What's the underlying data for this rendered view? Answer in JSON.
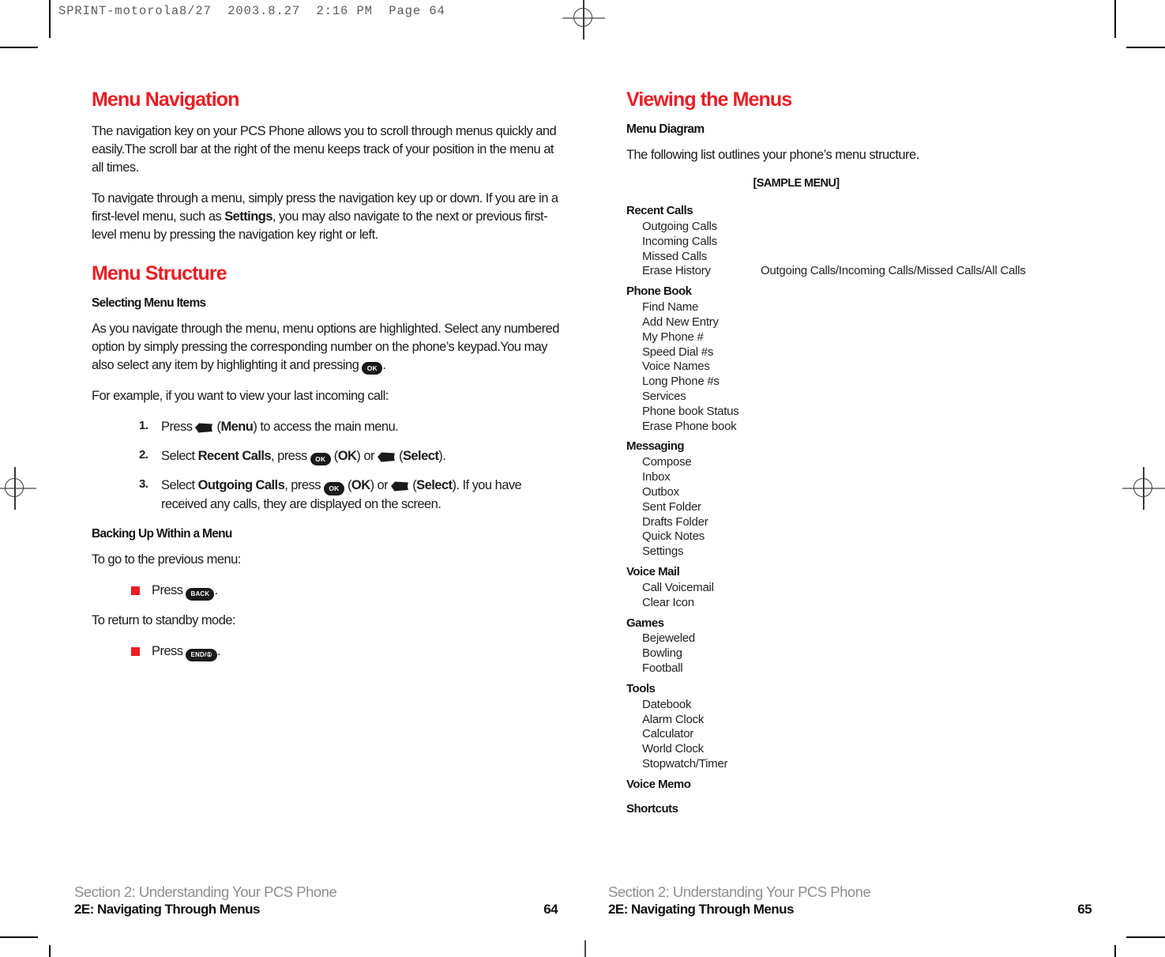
{
  "file_stamp": "SPRINT-motorola8/27  2003.8.27  2:16 PM  Page 64",
  "accent_red": "#ED1C24",
  "left_page": {
    "heading_1": "Menu Navigation",
    "para_1": "The navigation key on your PCS Phone allows you to scroll through menus quickly and easily.The scroll bar at the right of the menu keeps track of your position in the menu at all times.",
    "para_2_a": "To navigate through a menu, simply press the navigation key up or down. If you are in a first-level menu, such as ",
    "para_2_bold": "Settings",
    "para_2_b": ", you may also navigate to the next or previous first-level menu by pressing the navigation key right or left.",
    "heading_2": "Menu Structure",
    "subhead_1": "Selecting Menu Items",
    "para_3_a": "As you navigate through the menu, menu options are highlighted. Select any numbered option by simply pressing the corresponding number on the phone’s keypad.You may also select any item by highlighting it and pressing ",
    "para_3_b": ".",
    "para_4": "For example, if you want to view your last incoming call:",
    "steps": [
      {
        "num": "1.",
        "pre": "Press ",
        "key": "soft",
        "mid_open": " (",
        "label_bold": "Menu",
        "post": ") to access the main menu."
      },
      {
        "num": "2.",
        "pre": "Select ",
        "target_bold": "Recent Calls",
        "mid": ", press ",
        "ok_open": " (",
        "ok_bold": "OK",
        "ok_close": ") or ",
        "sel_open": " (",
        "sel_bold": "Select",
        "post": ")."
      },
      {
        "num": "3.",
        "pre": "Select ",
        "target_bold": "Outgoing Calls",
        "mid": ", press ",
        "ok_open": " (",
        "ok_bold": "OK",
        "ok_close": ") or ",
        "sel_open": " (",
        "sel_bold": "Select",
        "post": "). If you have received any calls, they are displayed on the screen."
      }
    ],
    "subhead_2": "Backing Up Within a Menu",
    "para_5": "To go to the previous menu:",
    "bullet_1_pre": "Press ",
    "bullet_1_key": "BACK",
    "bullet_1_post": ".",
    "para_6": "To return to standby mode:",
    "bullet_2_pre": "Press ",
    "bullet_2_key": "END/①",
    "bullet_2_post": ".",
    "footer_section": "Section 2: Understanding Your PCS Phone",
    "footer_title": "2E: Navigating Through Menus",
    "footer_page": "64"
  },
  "right_page": {
    "heading_1": "Viewing the Menus",
    "subhead_1": "Menu Diagram",
    "para_1": "The following list outlines your phone’s menu structure.",
    "sample_label": "[SAMPLE MENU]",
    "menu_groups": [
      {
        "title": "Recent Calls",
        "items": [
          {
            "label": "Outgoing Calls",
            "detail": ""
          },
          {
            "label": "Incoming Calls",
            "detail": ""
          },
          {
            "label": "Missed Calls",
            "detail": ""
          },
          {
            "label": "Erase History",
            "detail": "Outgoing Calls/Incoming Calls/Missed Calls/All Calls"
          }
        ]
      },
      {
        "title": "Phone Book",
        "items": [
          {
            "label": "Find Name",
            "detail": ""
          },
          {
            "label": "Add New Entry",
            "detail": ""
          },
          {
            "label": "My Phone #",
            "detail": ""
          },
          {
            "label": "Speed Dial #s",
            "detail": ""
          },
          {
            "label": "Voice Names",
            "detail": ""
          },
          {
            "label": "Long Phone #s",
            "detail": ""
          },
          {
            "label": "Services",
            "detail": ""
          },
          {
            "label": "Phone book Status",
            "detail": ""
          },
          {
            "label": "Erase Phone book",
            "detail": ""
          }
        ]
      },
      {
        "title": "Messaging",
        "items": [
          {
            "label": "Compose",
            "detail": ""
          },
          {
            "label": "Inbox",
            "detail": ""
          },
          {
            "label": "Outbox",
            "detail": ""
          },
          {
            "label": "Sent Folder",
            "detail": ""
          },
          {
            "label": "Drafts Folder",
            "detail": ""
          },
          {
            "label": "Quick Notes",
            "detail": ""
          },
          {
            "label": "Settings",
            "detail": ""
          }
        ]
      },
      {
        "title": "Voice Mail",
        "items": [
          {
            "label": "Call Voicemail",
            "detail": ""
          },
          {
            "label": "Clear Icon",
            "detail": ""
          }
        ]
      },
      {
        "title": "Games",
        "items": [
          {
            "label": "Bejeweled",
            "detail": ""
          },
          {
            "label": "Bowling",
            "detail": ""
          },
          {
            "label": "Football",
            "detail": ""
          }
        ]
      },
      {
        "title": "Tools",
        "items": [
          {
            "label": "Datebook",
            "detail": ""
          },
          {
            "label": "Alarm Clock",
            "detail": ""
          },
          {
            "label": "Calculator",
            "detail": ""
          },
          {
            "label": "World Clock",
            "detail": ""
          },
          {
            "label": "Stopwatch/Timer",
            "detail": ""
          }
        ]
      },
      {
        "title": "Voice Memo",
        "items": []
      },
      {
        "title": "Shortcuts",
        "items": []
      }
    ],
    "footer_section": "Section 2: Understanding Your PCS Phone",
    "footer_title": "2E: Navigating Through Menus",
    "footer_page": "65"
  }
}
